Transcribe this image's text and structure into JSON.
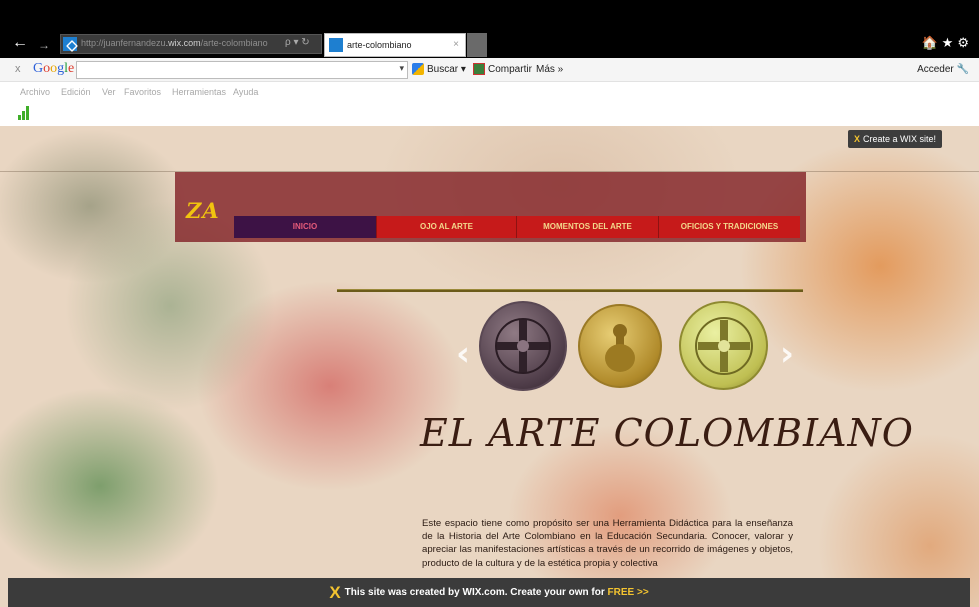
{
  "browser": {
    "url_prefix": "http://juanfernandezu",
    "url_domain": ".wix.com",
    "url_path": "/arte-colombiano",
    "tab_title": "arte-colombiano",
    "tab_close": "×",
    "nav_back": "←",
    "nav_forward": "→",
    "search_glyph": "ρ ▾ ↻",
    "top_icons": "🏠★⚙"
  },
  "google_bar": {
    "close": "x",
    "logo": [
      "G",
      "o",
      "o",
      "g",
      "l",
      "e"
    ],
    "dropdown": "▾",
    "buscar": "Buscar ▾",
    "compartir": "Compartir",
    "mas": "Más »",
    "acceder": "Acceder 🔧"
  },
  "menu": [
    "Archivo",
    "Edición",
    "Ver",
    "Favoritos",
    "Herramientas",
    "Ayuda"
  ],
  "site": {
    "wix_badge": "Create a WIX site!",
    "wix_badge_x": "X",
    "logo": "ZA",
    "nav": [
      "INICIO",
      "OJO AL ARTE",
      "MOMENTOS DEL ARTE",
      "OFICIOS Y TRADICIONES"
    ],
    "active_nav": "INICIO",
    "arrow_prev": "‹",
    "arrow_next": "›",
    "title": "EL ARTE COLOMBIANO",
    "description": "Este espacio tiene como propósito ser una Herramienta Didáctica para la enseñanza de la Historia del Arte Colombiano en la Educación Secundaria. Conocer, valorar y apreciar las manifestaciones artísticas a través de un recorrido de imágenes y objetos, producto de la cultura y de la estética propia y colectiva",
    "footer_x": "X",
    "footer_text": "This site was created by WIX.com. Create your own for ",
    "footer_free": "FREE >>"
  },
  "colors": {
    "nav_active_bg": "#3d1245",
    "nav_bg": "#c61a1a",
    "header_band": "#82232a",
    "title": "#3a1d12",
    "wix_yellow": "#f4c430"
  }
}
